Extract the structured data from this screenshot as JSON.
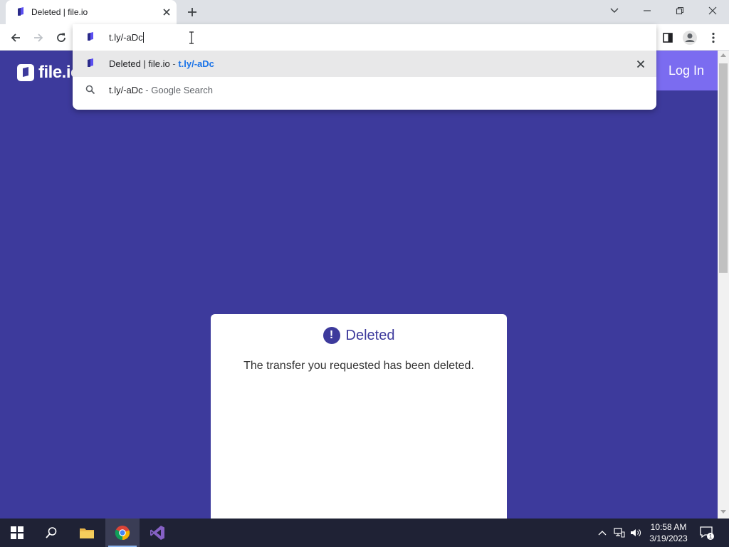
{
  "browser": {
    "tab": {
      "title": "Deleted | file.io"
    },
    "omnibox": {
      "input_value": "t.ly/-aDc",
      "suggestions": [
        {
          "title": "Deleted | file.io",
          "separator": " - ",
          "url": "t.ly/-aDc"
        },
        {
          "query": "t.ly/-aDc",
          "separator": " - ",
          "source": "Google Search"
        }
      ]
    }
  },
  "page": {
    "logo_text": "file.io",
    "login_label": "Log In",
    "card": {
      "title": "Deleted",
      "message": "The transfer you requested has been deleted."
    }
  },
  "taskbar": {
    "clock_time": "10:58 AM",
    "clock_date": "3/19/2023",
    "notification_count": "1"
  },
  "colors": {
    "brand_purple": "#3d3a9c",
    "login_button": "#7b6cf0",
    "taskbar": "#1f2235"
  }
}
